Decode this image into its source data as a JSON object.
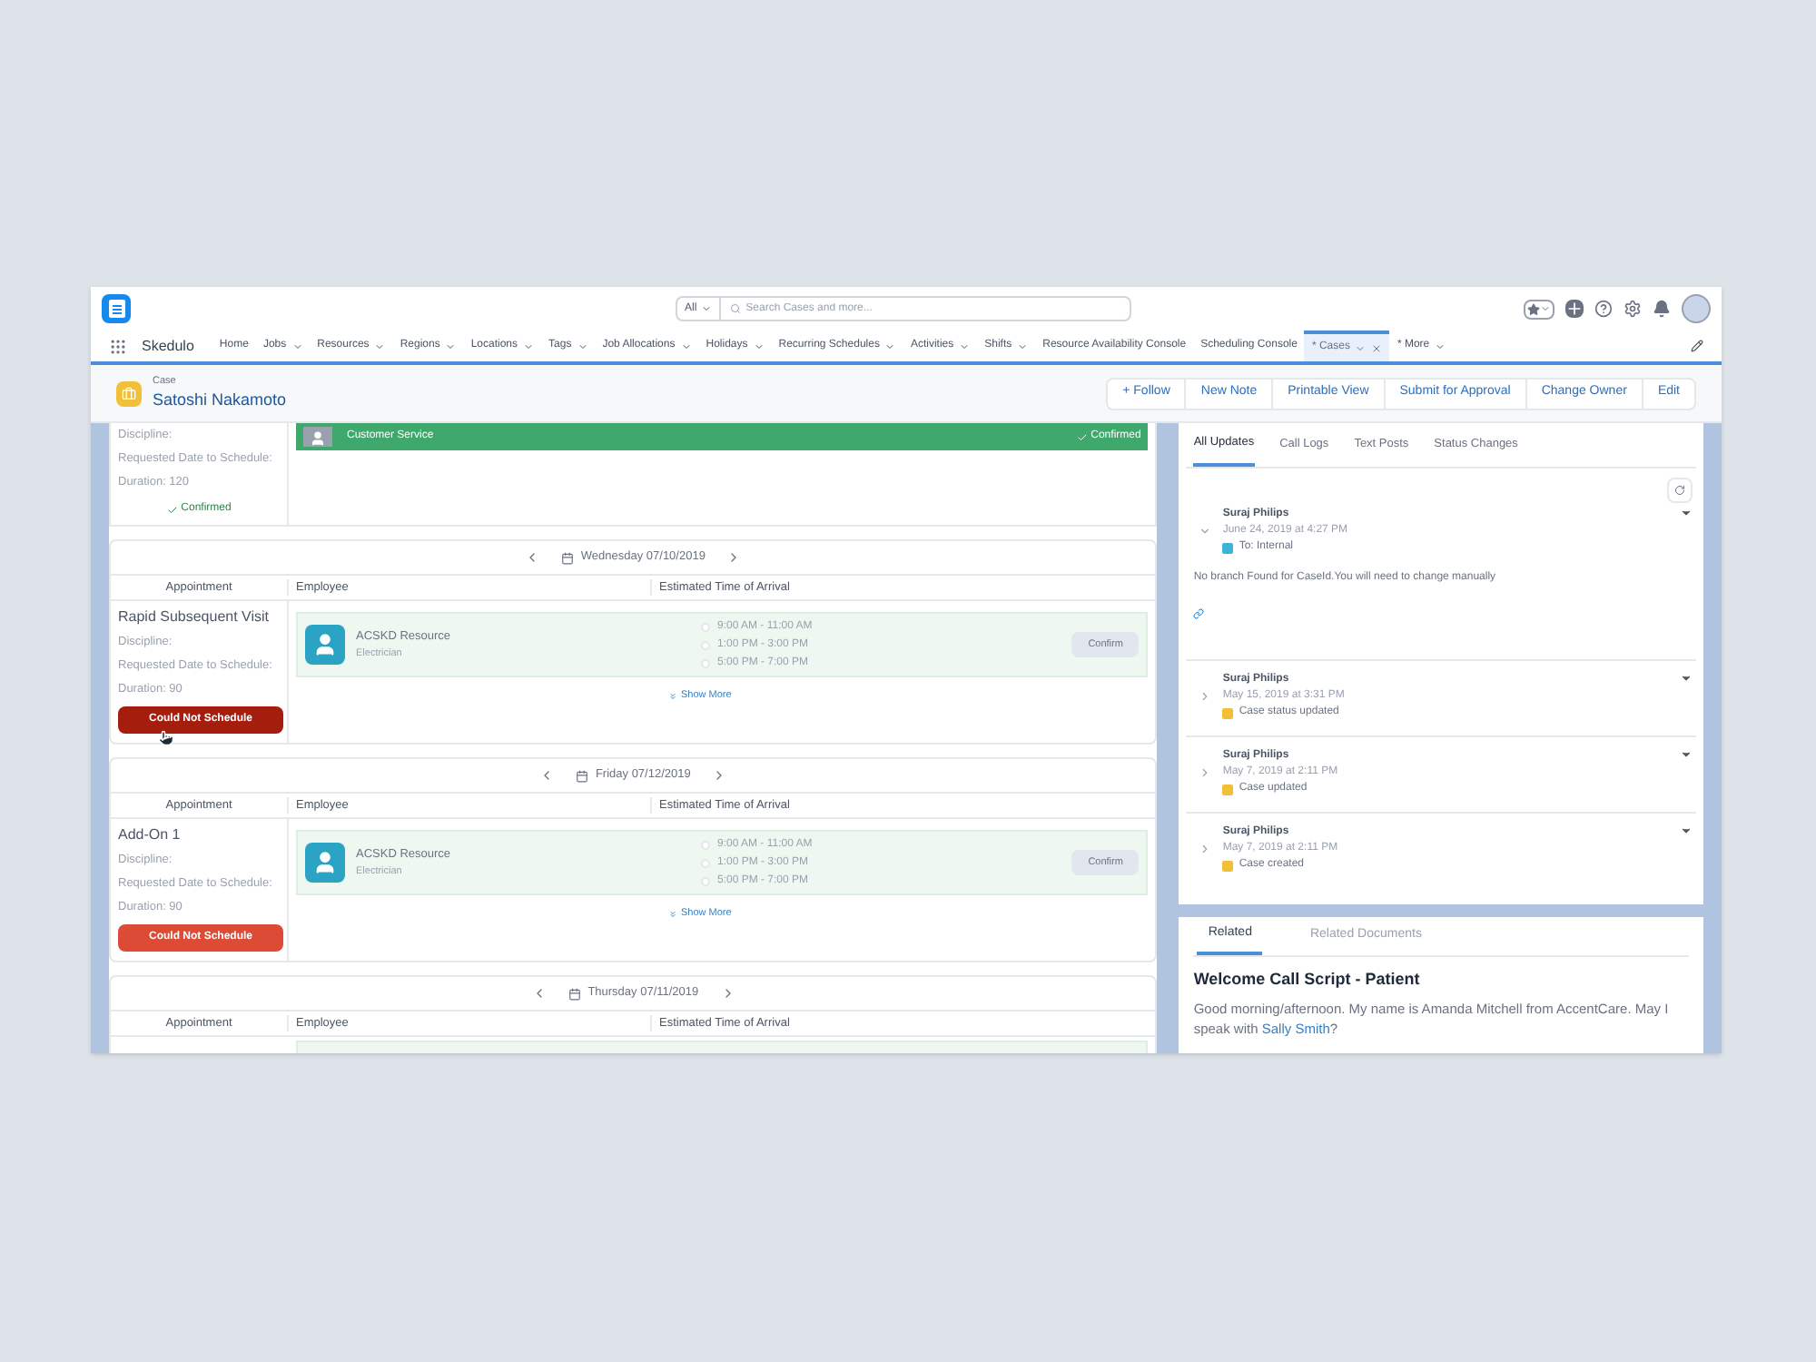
{
  "header": {
    "search_scope": "All",
    "search_placeholder": "Search Cases and more..."
  },
  "nav": {
    "app_name": "Skedulo",
    "items": [
      {
        "label": "Home",
        "menu": false,
        "selected": false
      },
      {
        "label": "Jobs",
        "menu": true,
        "selected": false
      },
      {
        "label": "Resources",
        "menu": true,
        "selected": false
      },
      {
        "label": "Regions",
        "menu": true,
        "selected": false
      },
      {
        "label": "Locations",
        "menu": true,
        "selected": false
      },
      {
        "label": "Tags",
        "menu": true,
        "selected": false
      },
      {
        "label": "Job Allocations",
        "menu": true,
        "selected": false
      },
      {
        "label": "Holidays",
        "menu": true,
        "selected": false
      },
      {
        "label": "Recurring Schedules",
        "menu": true,
        "selected": false
      },
      {
        "label": "Activities",
        "menu": true,
        "selected": false
      },
      {
        "label": "Shifts",
        "menu": true,
        "selected": false
      },
      {
        "label": "Resource Availability Console",
        "menu": false,
        "selected": false
      },
      {
        "label": "Scheduling Console",
        "menu": false,
        "selected": false
      },
      {
        "label": "* Cases",
        "menu": true,
        "selected": true
      },
      {
        "label": "* More",
        "menu": true,
        "selected": false
      }
    ]
  },
  "record": {
    "type": "Case",
    "name": "Satoshi Nakamoto",
    "actions": [
      "+ Follow",
      "New Note",
      "Printable View",
      "Submit for Approval",
      "Change Owner",
      "Edit"
    ]
  },
  "confirmed_card": {
    "fields": [
      "Discipline:",
      "Requested Date to Schedule:",
      "Duration: 120"
    ],
    "status": "Confirmed",
    "employee": "Customer Service",
    "employee_status": "Confirmed"
  },
  "cards": [
    {
      "date": "Wednesday 07/10/2019",
      "columns": [
        "Appointment",
        "Employee",
        "Estimated Time of Arrival"
      ],
      "appointment": "Rapid Subsequent Visit",
      "fields": [
        "Discipline:",
        "Requested Date to Schedule:",
        "Duration: 90"
      ],
      "button": "Could Not Schedule",
      "hovered": true,
      "employee": "ACSKD Resource",
      "role": "Electrician",
      "slots": [
        {
          "label": "9:00 AM - 11:00 AM",
          "selected": false
        },
        {
          "label": "1:00 PM - 3:00 PM",
          "selected": false
        },
        {
          "label": "5:00 PM - 7:00 PM",
          "selected": false
        }
      ],
      "confirm": "Confirm",
      "show_more": "Show More"
    },
    {
      "date": "Friday 07/12/2019",
      "columns": [
        "Appointment",
        "Employee",
        "Estimated Time of Arrival"
      ],
      "appointment": "Add-On 1",
      "fields": [
        "Discipline:",
        "Requested Date to Schedule:",
        "Duration: 90"
      ],
      "button": "Could Not Schedule",
      "hovered": false,
      "employee": "ACSKD Resource",
      "role": "Electrician",
      "slots": [
        {
          "label": "9:00 AM - 11:00 AM",
          "selected": false
        },
        {
          "label": "1:00 PM - 3:00 PM",
          "selected": false
        },
        {
          "label": "5:00 PM - 7:00 PM",
          "selected": false
        }
      ],
      "confirm": "Confirm",
      "show_more": "Show More"
    },
    {
      "date": "Thursday 07/11/2019",
      "columns": [
        "Appointment",
        "Employee",
        "Estimated Time of Arrival"
      ]
    }
  ],
  "feed": {
    "tabs": [
      {
        "label": "All Updates",
        "selected": true
      },
      {
        "label": "Call Logs",
        "selected": false
      },
      {
        "label": "Text Posts",
        "selected": false
      },
      {
        "label": "Status Changes",
        "selected": false
      }
    ],
    "items": [
      {
        "author": "Suraj Philips",
        "time": "June 24, 2019 at 4:27 PM",
        "detail": "To: Internal",
        "color": "#3bb4d8",
        "expanded": true,
        "body": "No branch Found for CaseId.You will need to change manually"
      },
      {
        "author": "Suraj Philips",
        "time": "May 15, 2019 at 3:31 PM",
        "detail": "Case status updated",
        "color": "#f2c038",
        "expanded": false
      },
      {
        "author": "Suraj Philips",
        "time": "May 7, 2019 at 2:11 PM",
        "detail": "Case updated",
        "color": "#f2c038",
        "expanded": false
      },
      {
        "author": "Suraj Philips",
        "time": "May 7, 2019 at 2:11 PM",
        "detail": "Case created",
        "color": "#f2c038",
        "expanded": false
      }
    ]
  },
  "related": {
    "tabs": [
      {
        "label": "Related",
        "selected": true
      },
      {
        "label": "Related Documents",
        "selected": false
      }
    ],
    "title": "Welcome Call Script - Patient",
    "text": "Good morning/afternoon. My name is Amanda Mitchell from AccentCare. May I speak with ",
    "link": "Sally Smith",
    "text_end": "?"
  }
}
